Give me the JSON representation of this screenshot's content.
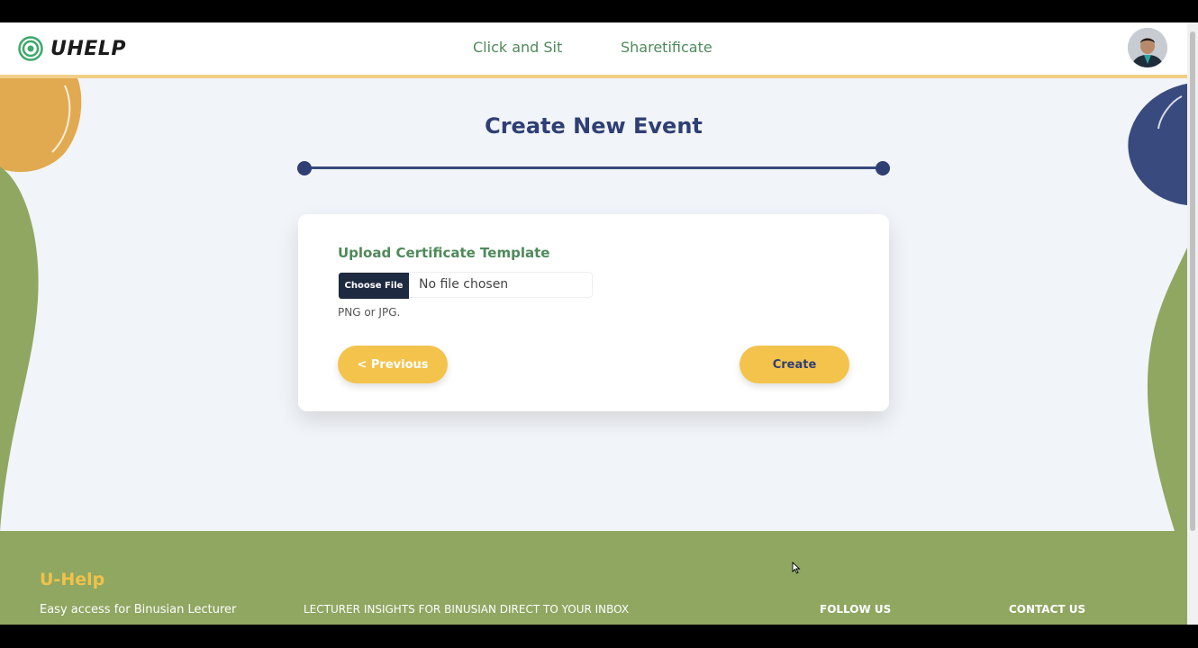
{
  "header": {
    "brand": "UHELP",
    "nav": [
      "Click and Sit",
      "Sharetificate"
    ]
  },
  "page": {
    "title": "Create New Event"
  },
  "form": {
    "upload_label": "Upload Certificate Template",
    "choose_file_label": "Choose File",
    "file_status": "No file chosen",
    "hint": "PNG or JPG.",
    "previous_label": "< Previous",
    "create_label": "Create"
  },
  "footer": {
    "brand": "U-Help",
    "tagline": "Easy access for Binusian Lecturer",
    "insights": "LECTURER INSIGHTS FOR BINUSIAN DIRECT TO YOUR INBOX",
    "follow": "FOLLOW US",
    "contact": "CONTACT US"
  },
  "colors": {
    "primary_navy": "#2f3f74",
    "accent_yellow": "#f4c34c",
    "brand_green": "#4f8a5a",
    "footer_green": "#8fa761",
    "header_border": "#f2cf86"
  },
  "icons": {
    "logo": "target-rings-icon",
    "avatar": "user-avatar",
    "cursor": "mouse-pointer-icon"
  }
}
